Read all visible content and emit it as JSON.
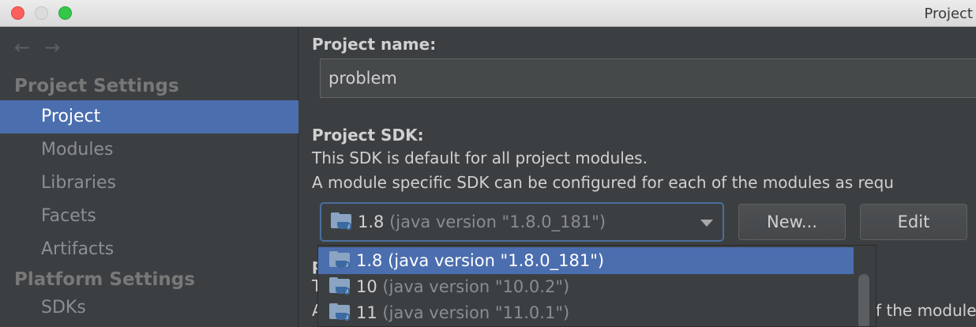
{
  "window": {
    "title": "Project"
  },
  "nav": {
    "back": "←",
    "forward": "→"
  },
  "sidebar": {
    "project_settings_header": "Project Settings",
    "platform_settings_header": "Platform Settings",
    "items": [
      {
        "label": "Project",
        "selected": true
      },
      {
        "label": "Modules"
      },
      {
        "label": "Libraries"
      },
      {
        "label": "Facets"
      },
      {
        "label": "Artifacts"
      }
    ],
    "platform_items": [
      {
        "label": "SDKs"
      }
    ]
  },
  "main": {
    "project_name_label": "Project name:",
    "project_name_value": "problem",
    "sdk_label": "Project SDK:",
    "sdk_desc1": "This SDK is default for all project modules.",
    "sdk_desc2": "A module specific SDK can be configured for each of the modules as requ",
    "sdk_selected_version": "1.8",
    "sdk_selected_desc": "(java version \"1.8.0_181\")",
    "new_button": "New...",
    "edit_button": "Edit",
    "behind_letter": "p",
    "behind_t": "T",
    "behind_a": "A",
    "behind_tail": "f the module"
  },
  "dropdown": {
    "options": [
      {
        "version": "1.8",
        "desc": "(java version \"1.8.0_181\")",
        "selected": true
      },
      {
        "version": "10",
        "desc": "(java version \"10.0.2\")"
      },
      {
        "version": "11",
        "desc": "(java version \"11.0.1\")"
      }
    ]
  },
  "colors": {
    "selection": "#4b6eaf",
    "background": "#3c3f41",
    "focus_border": "#4a6e9b"
  }
}
